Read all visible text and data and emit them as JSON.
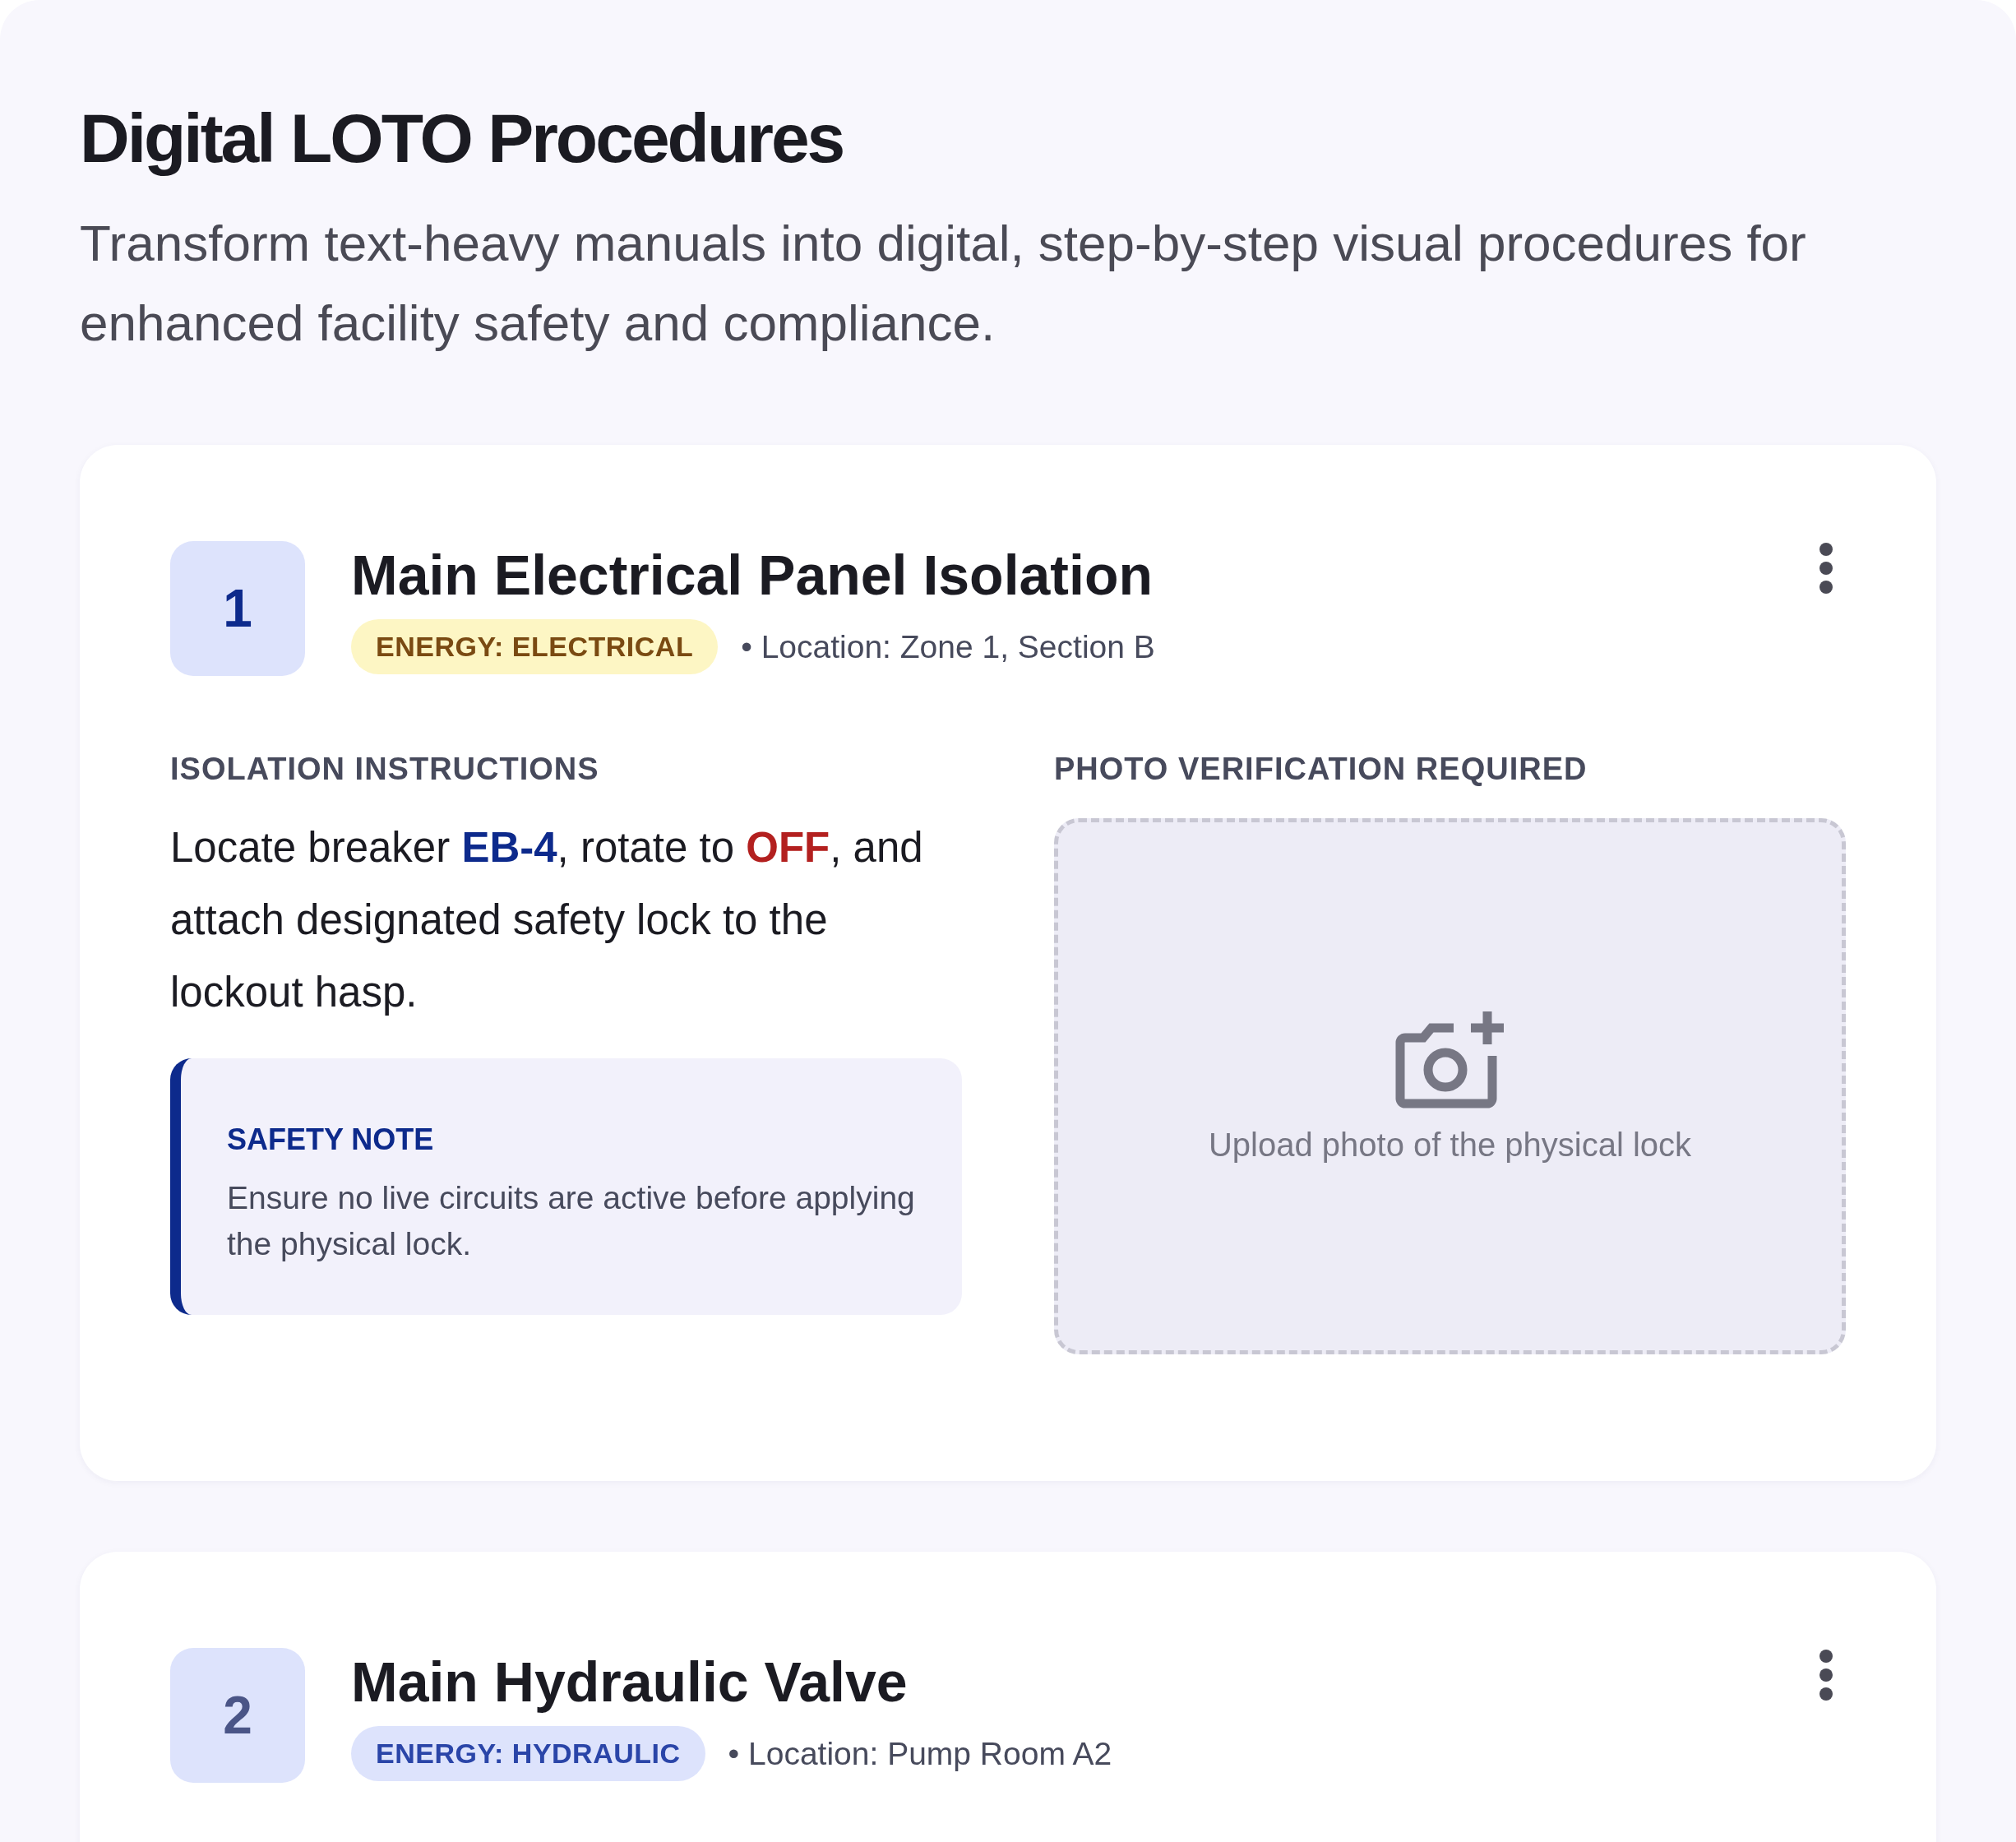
{
  "page": {
    "title": "Digital LOTO Procedures",
    "subtitle": "Transform text-heavy manuals into digital, step-by-step visual procedures for enhanced facility safety and compliance."
  },
  "steps": [
    {
      "number": "1",
      "active": true,
      "title": "Main Electrical Panel Isolation",
      "energy": {
        "label": "ENERGY: ELECTRICAL",
        "kind": "electrical"
      },
      "location": "• Location: Zone 1, Section B",
      "instructions_label": "ISOLATION INSTRUCTIONS",
      "instructions": "Locate breaker **EB-4**, rotate to *OFF*, and attach designated safety lock to the lockout hasp.",
      "safety_note": {
        "title": "SAFETY NOTE",
        "text": "Ensure no live circuits are active before applying the physical lock."
      },
      "photo": {
        "label": "PHOTO VERIFICATION REQUIRED",
        "prompt": "Upload photo of the physical lock"
      }
    },
    {
      "number": "2",
      "active": false,
      "title": "Main Hydraulic Valve",
      "energy": {
        "label": "ENERGY: HYDRAULIC",
        "kind": "hydraulic"
      },
      "location": "• Location: Pump Room A2"
    }
  ]
}
